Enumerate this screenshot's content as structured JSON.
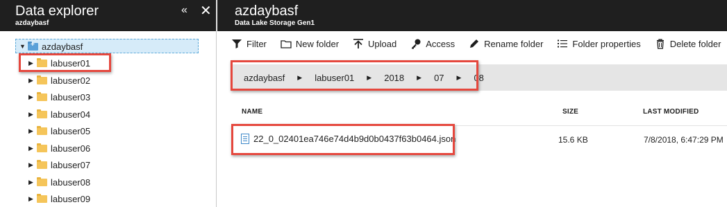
{
  "explorer": {
    "title": "Data explorer",
    "account": "azdaybasf",
    "collapse_glyph": "«",
    "close_glyph": "✕",
    "tree": {
      "root": "azdaybasf",
      "children": [
        "labuser01",
        "labuser02",
        "labuser03",
        "labuser04",
        "labuser05",
        "labuser06",
        "labuser07",
        "labuser08",
        "labuser09"
      ]
    }
  },
  "main": {
    "title": "azdaybasf",
    "subtitle": "Data Lake Storage Gen1",
    "toolbar": [
      {
        "label": "Filter",
        "icon": "filter-icon"
      },
      {
        "label": "New folder",
        "icon": "new-folder-icon"
      },
      {
        "label": "Upload",
        "icon": "upload-icon"
      },
      {
        "label": "Access",
        "icon": "key-icon"
      },
      {
        "label": "Rename folder",
        "icon": "pencil-icon"
      },
      {
        "label": "Folder properties",
        "icon": "list-icon"
      },
      {
        "label": "Delete folder",
        "icon": "trash-icon"
      }
    ],
    "breadcrumb": [
      "azdaybasf",
      "labuser01",
      "2018",
      "07",
      "08"
    ],
    "columns": {
      "name": "NAME",
      "size": "SIZE",
      "modified": "LAST MODIFIED"
    },
    "files": [
      {
        "name": "22_0_02401ea746e74d4b9d0b0437f63b0464.json",
        "size": "15.6 KB",
        "modified": "7/8/2018, 6:47:29 PM"
      }
    ]
  },
  "colors": {
    "header_bg": "#1f1f1f",
    "highlight": "#e5473d",
    "selected_bg": "#d6ebf9",
    "folder": "#f5c55a"
  }
}
